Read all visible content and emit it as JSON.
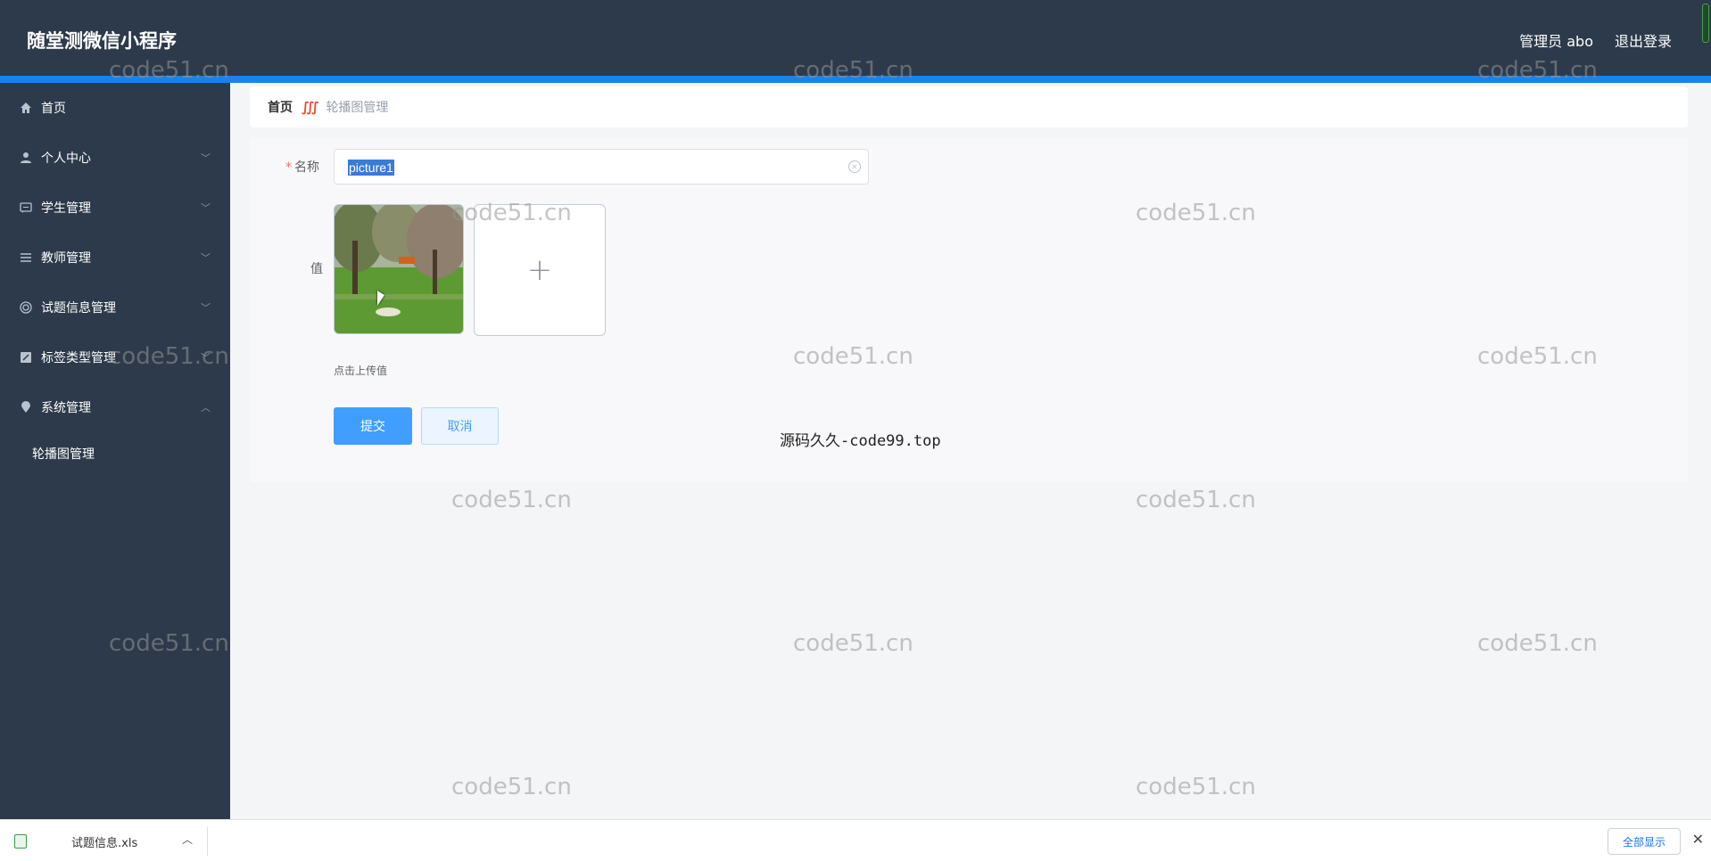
{
  "header": {
    "app_title": "随堂测微信小程序",
    "admin_label": "管理员 abo",
    "logout_label": "退出登录"
  },
  "sidebar": {
    "items": [
      {
        "label": "首页",
        "icon": "home-icon"
      },
      {
        "label": "个人中心",
        "icon": "user-icon"
      },
      {
        "label": "学生管理",
        "icon": "chat-icon"
      },
      {
        "label": "教师管理",
        "icon": "list-icon"
      },
      {
        "label": "试题信息管理",
        "icon": "help-circle-icon"
      },
      {
        "label": "标签类型管理",
        "icon": "edit-icon"
      },
      {
        "label": "系统管理",
        "icon": "location-icon"
      }
    ],
    "submenu": [
      {
        "label": "轮播图管理"
      }
    ]
  },
  "breadcrumb": {
    "home": "首页",
    "current": "轮播图管理"
  },
  "form": {
    "name_label": "名称",
    "name_value": "picture1",
    "value_label": "值",
    "upload_tip": "点击上传值",
    "submit_label": "提交",
    "cancel_label": "取消"
  },
  "overlay_text": "源码久久-code99.top",
  "watermark_text": "code51.cn",
  "download_bar": {
    "file_name": "试题信息.xls",
    "show_all_label": "全部显示"
  },
  "colors": {
    "header_bg": "#2d3a4b",
    "accent": "#1b82e8",
    "primary_button": "#409eff"
  }
}
